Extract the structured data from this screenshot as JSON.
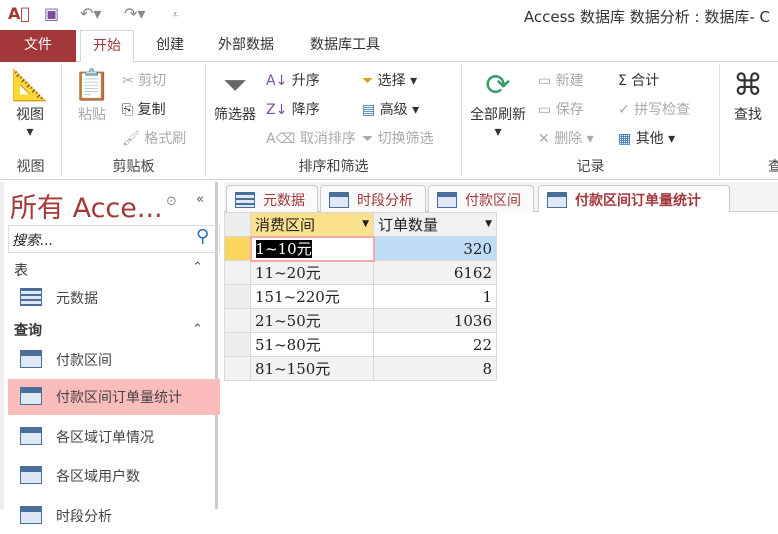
{
  "title": "Access 数据库 数据分析 : 数据库- C",
  "ribbon_tabs": [
    "文件",
    "开始",
    "创建",
    "外部数据",
    "数据库工具"
  ],
  "ribbon": {
    "view": {
      "label": "视图",
      "group": "视图"
    },
    "clipboard": {
      "paste": "粘贴",
      "cut": "剪切",
      "copy": "复制",
      "format_painter": "格式刷",
      "group": "剪贴板"
    },
    "sort_filter": {
      "filter": "筛选器",
      "asc": "升序",
      "desc": "降序",
      "clear_sort": "取消排序",
      "selection": "选择",
      "advanced": "高级",
      "toggle_filter": "切换筛选",
      "group": "排序和筛选"
    },
    "records": {
      "refresh_all": "全部刷新",
      "new": "新建",
      "save": "保存",
      "delete": "删除",
      "totals": "合计",
      "spelling": "拼写检查",
      "more": "其他",
      "group": "记录"
    },
    "find": {
      "find": "查找",
      "group": "查"
    }
  },
  "nav": {
    "title": "所有 Acce...",
    "search_placeholder": "搜索...",
    "sections": [
      {
        "label": "表",
        "items": [
          "元数据"
        ]
      },
      {
        "label": "查询",
        "items": [
          "付款区间",
          "付款区间订单量统计",
          "各区域订单情况",
          "各区域用户数",
          "时段分析"
        ]
      }
    ],
    "selected": "付款区间订单量统计"
  },
  "doc_tabs": [
    "元数据",
    "时段分析",
    "付款区间",
    "付款区间订单量统计"
  ],
  "datasheet": {
    "columns": [
      "消费区间",
      "订单数量"
    ],
    "rows": [
      [
        "1~10元",
        "320"
      ],
      [
        "11~20元",
        "6162"
      ],
      [
        "151~220元",
        "1"
      ],
      [
        "21~50元",
        "1036"
      ],
      [
        "51~80元",
        "22"
      ],
      [
        "81~150元",
        "8"
      ]
    ]
  }
}
